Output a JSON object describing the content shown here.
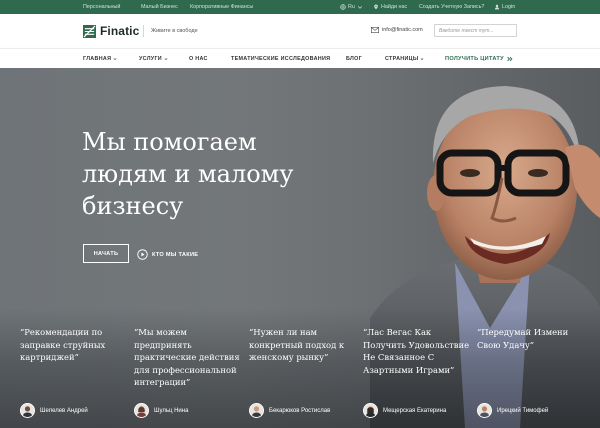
{
  "topbar": {
    "left_links": [
      "Персональный",
      "Малый Бизнес",
      "Корпоративные Финансы"
    ],
    "lang": "Ru",
    "find_us": "Найди нас",
    "create_account": "Создать Учетную Запись?",
    "login": "Login"
  },
  "header": {
    "logo": "Finatic",
    "tagline": "Живите в свободе",
    "email": "info@finatic.com",
    "search_placeholder": "Введите текст тут..."
  },
  "nav": {
    "items": [
      "ГЛАВНАЯ",
      "УСЛУГИ",
      "О НАС",
      "ТЕМАТИЧЕСКИЕ ИССЛЕДОВАНИЯ",
      "БЛОГ",
      "СТРАНИЦЫ"
    ],
    "cta": "ПОЛУЧИТЬ ЦИТАТУ"
  },
  "hero": {
    "headline_lines": [
      "Мы помогаем",
      "людям и малому",
      "бизнесу"
    ],
    "start_button": "НАЧАТЬ",
    "who_link": "КТО МЫ ТАКИЕ"
  },
  "testimonials": [
    {
      "quote": "“Рекомендации по заправке струйных картриджей”",
      "author": "Шепелев Андрей"
    },
    {
      "quote": "“Мы можем предпринять практические действия для профессиональной интеграции”",
      "author": "Шульц Нина"
    },
    {
      "quote": "“Нужен ли нам конкретный подход к женскому рынку”",
      "author": "Бекарюков Ростислав"
    },
    {
      "quote": "“Лас Вегас Как Получить Удовольствие Не Связанное С Азартными Играми”",
      "author": "Мещерская Екатерина"
    },
    {
      "quote": "“Передумай Измени Свою Удачу”",
      "author": "Ирецкий Тимофей"
    }
  ],
  "colors": {
    "brand_green": "#2f6a4f",
    "hero_gray": "#6f7478"
  }
}
